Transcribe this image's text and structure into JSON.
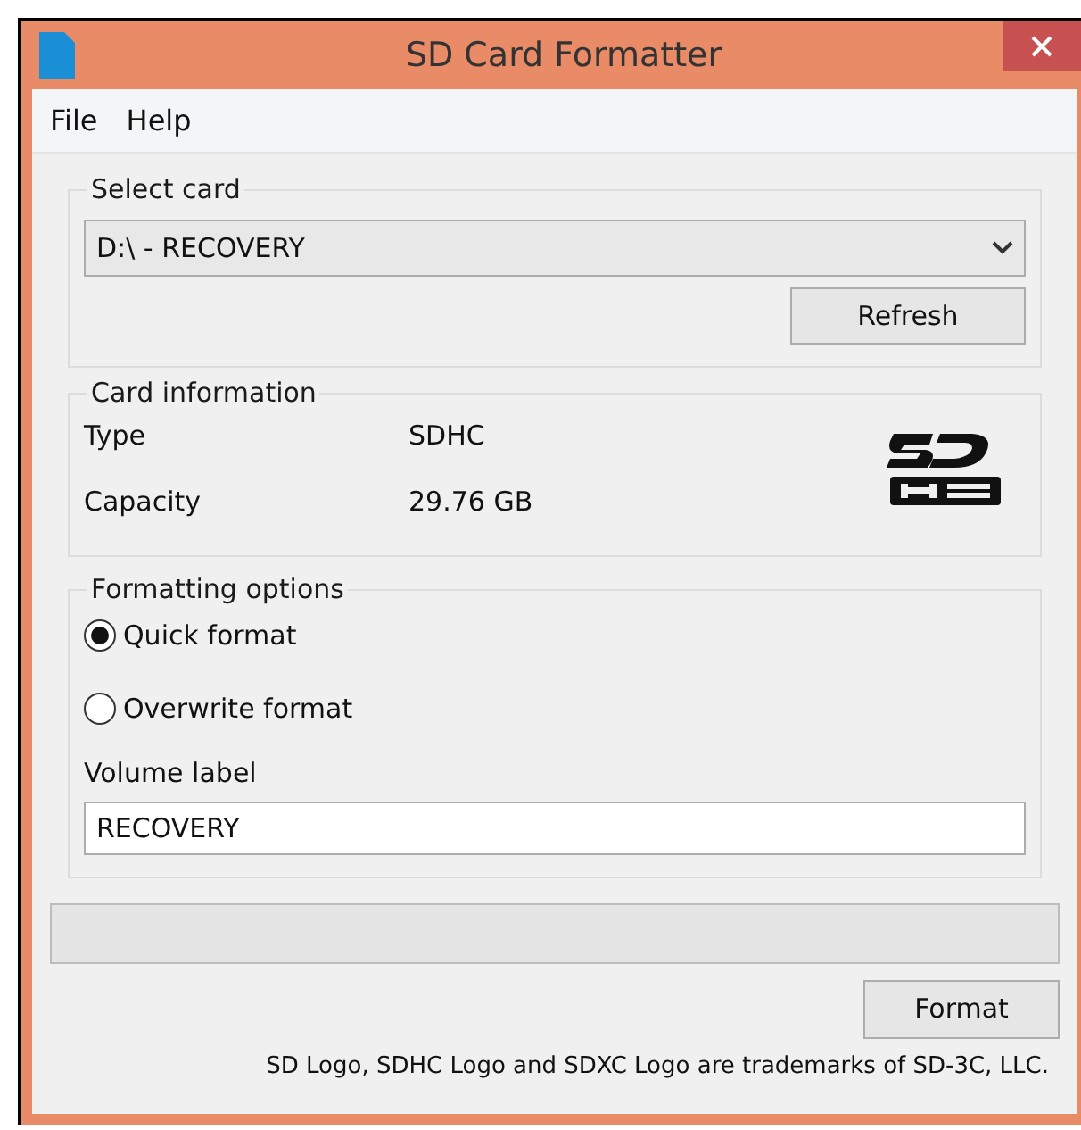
{
  "window": {
    "title": "SD Card Formatter"
  },
  "menu": [
    "File",
    "Help"
  ],
  "select_card": {
    "title": "Select card",
    "value": "D:\\ - RECOVERY",
    "button": "Refresh"
  },
  "card_information": {
    "title": "Card information",
    "rows": [
      {
        "label": "Type",
        "value": "SDHC"
      },
      {
        "label": "Capacity",
        "value": "29.76 GB"
      }
    ]
  },
  "formatting_options": {
    "title": "Formatting options",
    "options": [
      {
        "label": "Quick format",
        "selected": true
      },
      {
        "label": "Overwrite format",
        "selected": false
      }
    ],
    "volume_label": {
      "label": "Volume label",
      "value": "RECOVERY"
    }
  },
  "progress": {
    "level": 0
  },
  "format_button": "Format",
  "footer": "SD Logo, SDHC Logo and SDXC Logo are trademarks of SD-3C, LLC."
}
